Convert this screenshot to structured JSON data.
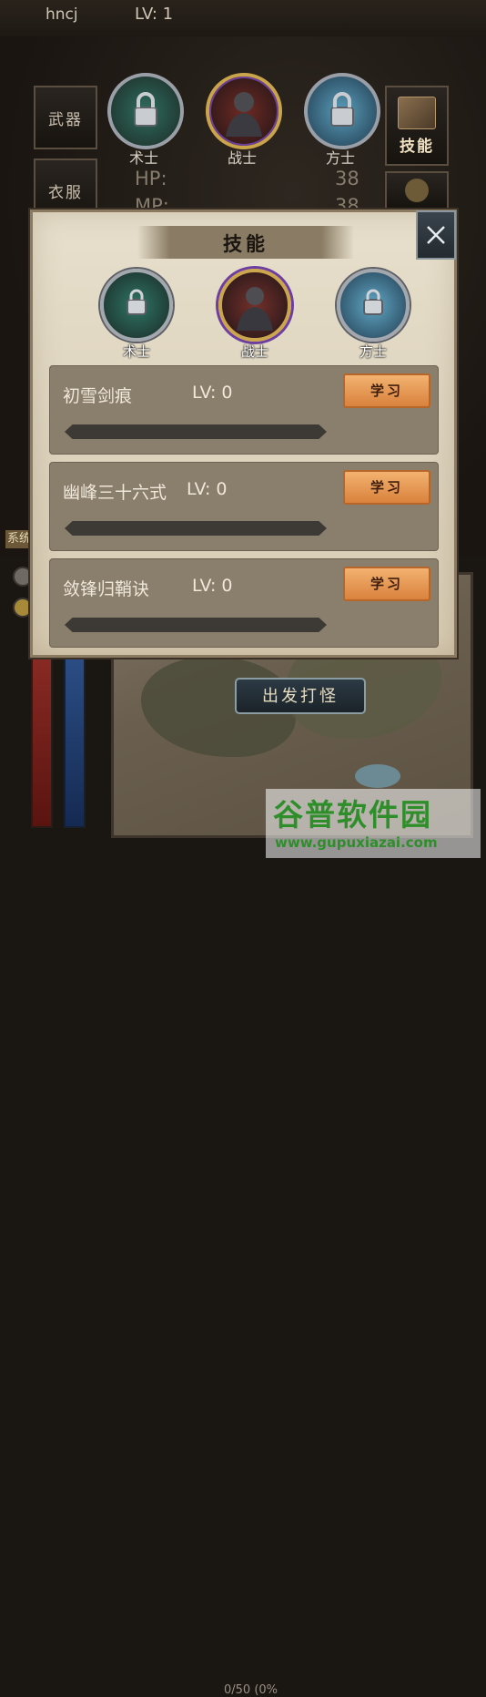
{
  "header": {
    "username": "hncj",
    "level": "LV: 1"
  },
  "side_tabs": {
    "weapon": "武器",
    "clothes": "衣服",
    "skill": "技能"
  },
  "bg_characters": [
    {
      "name": "术士",
      "locked": true
    },
    {
      "name": "战士",
      "locked": false
    },
    {
      "name": "方士",
      "locked": true
    }
  ],
  "stats": {
    "hp_label": "HP:",
    "hp_value": "38",
    "mp_label": "MP:",
    "mp_value": "38"
  },
  "system_tab": "系统",
  "map": {
    "go_button": "出发打怪"
  },
  "exp": {
    "text": "0/50 (0%"
  },
  "watermark": {
    "title": "谷普软件园",
    "url": "www.gupuxiazai.com"
  },
  "popup": {
    "title": "技能",
    "characters": [
      {
        "name": "术士",
        "locked": true
      },
      {
        "name": "战士",
        "locked": false
      },
      {
        "name": "方士",
        "locked": true
      }
    ],
    "skills": [
      {
        "name": "初雪剑痕",
        "level": "LV: 0",
        "button": "学习",
        "progress": 0
      },
      {
        "name": "幽峰三十六式",
        "level": "LV: 0",
        "button": "学习",
        "progress": 0
      },
      {
        "name": "敛锋归鞘诀",
        "level": "LV: 0",
        "button": "学习",
        "progress": 0
      }
    ]
  },
  "colors": {
    "learn_button": "#e89a52",
    "panel": "#e3dac5",
    "row": "#8a7e6c"
  }
}
